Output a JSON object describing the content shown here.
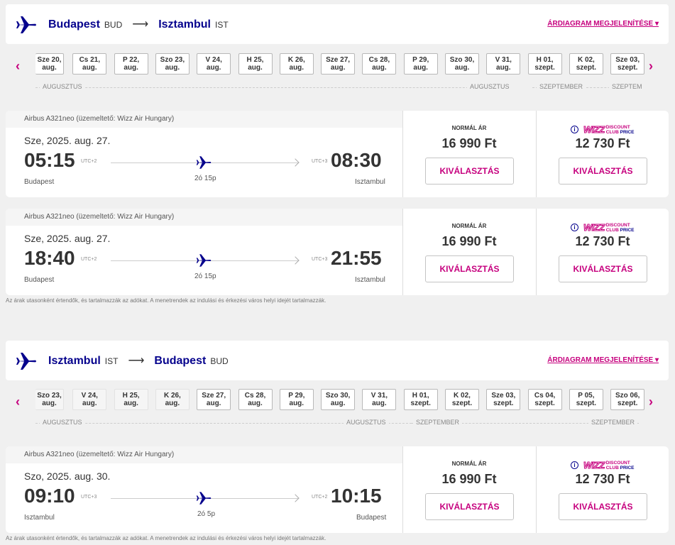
{
  "outbound": {
    "from_city": "Budapest",
    "from_code": "BUD",
    "to_city": "Isztambul",
    "to_code": "IST",
    "chart_link": "ÁRDIAGRAM MEGJELENÍTÉSE ▾",
    "dates": [
      {
        "day": "Sze 20,",
        "month": "aug."
      },
      {
        "day": "Cs 21,",
        "month": "aug."
      },
      {
        "day": "P 22,",
        "month": "aug."
      },
      {
        "day": "Szo 23,",
        "month": "aug."
      },
      {
        "day": "V 24,",
        "month": "aug."
      },
      {
        "day": "H 25,",
        "month": "aug."
      },
      {
        "day": "K 26,",
        "month": "aug."
      },
      {
        "day": "Sze 27,",
        "month": "aug."
      },
      {
        "day": "Cs 28,",
        "month": "aug."
      },
      {
        "day": "P 29,",
        "month": "aug."
      },
      {
        "day": "Szo 30,",
        "month": "aug."
      },
      {
        "day": "V 31,",
        "month": "aug."
      },
      {
        "day": "H 01,",
        "month": "szept."
      },
      {
        "day": "K 02,",
        "month": "szept."
      },
      {
        "day": "Sze 03,",
        "month": "szept."
      }
    ],
    "months": [
      "AUGUSZTUS",
      "AUGUSZTUS",
      "SZEPTEMBER",
      "SZEPTEM"
    ],
    "flights": [
      {
        "aircraft": "Airbus A321neo (üzemeltető: Wizz Air Hungary)",
        "date": "Sze, 2025. aug. 27.",
        "dep_time": "05:15",
        "dep_utc": "UTC+2",
        "dep_city": "Budapest",
        "arr_time": "08:30",
        "arr_utc": "UTC+3",
        "arr_city": "Isztambul",
        "duration": "2ó 15p",
        "normal_label": "NORMÁL ÁR",
        "normal_price": "16 990 Ft",
        "club_price": "12 730 Ft",
        "select": "KIVÁLASZTÁS"
      },
      {
        "aircraft": "Airbus A321neo (üzemeltető: Wizz Air Hungary)",
        "date": "Sze, 2025. aug. 27.",
        "dep_time": "18:40",
        "dep_utc": "UTC+2",
        "dep_city": "Budapest",
        "arr_time": "21:55",
        "arr_utc": "UTC+3",
        "arr_city": "Isztambul",
        "duration": "2ó 15p",
        "normal_label": "NORMÁL ÁR",
        "normal_price": "16 990 Ft",
        "club_price": "12 730 Ft",
        "select": "KIVÁLASZTÁS"
      }
    ],
    "note": "Az árak utasonként értendők, és tartalmazzák az adókat. A menetrendek az indulási és érkezési város helyi idejét tartalmazzák."
  },
  "return": {
    "from_city": "Isztambul",
    "from_code": "IST",
    "to_city": "Budapest",
    "to_code": "BUD",
    "chart_link": "ÁRDIAGRAM MEGJELENÍTÉSE ▾",
    "dates": [
      {
        "day": "Szo 23,",
        "month": "aug."
      },
      {
        "day": "V 24,",
        "month": "aug."
      },
      {
        "day": "H 25,",
        "month": "aug."
      },
      {
        "day": "K 26,",
        "month": "aug."
      },
      {
        "day": "Sze 27,",
        "month": "aug."
      },
      {
        "day": "Cs 28,",
        "month": "aug."
      },
      {
        "day": "P 29,",
        "month": "aug."
      },
      {
        "day": "Szo 30,",
        "month": "aug."
      },
      {
        "day": "V 31,",
        "month": "aug."
      },
      {
        "day": "H 01,",
        "month": "szept."
      },
      {
        "day": "K 02,",
        "month": "szept."
      },
      {
        "day": "Sze 03,",
        "month": "szept."
      },
      {
        "day": "Cs 04,",
        "month": "szept."
      },
      {
        "day": "P 05,",
        "month": "szept."
      },
      {
        "day": "Szo 06,",
        "month": "szept."
      }
    ],
    "months": [
      "AUGUSZTUS",
      "AUGUSZTUS",
      "SZEPTEMBER",
      "SZEPTEMBER"
    ],
    "flights": [
      {
        "aircraft": "Airbus A321neo (üzemeltető: Wizz Air Hungary)",
        "date": "Szo, 2025. aug. 30.",
        "dep_time": "09:10",
        "dep_utc": "UTC+3",
        "dep_city": "Isztambul",
        "arr_time": "10:15",
        "arr_utc": "UTC+2",
        "arr_city": "Budapest",
        "duration": "2ó 5p",
        "normal_label": "NORMÁL ÁR",
        "normal_price": "16 990 Ft",
        "club_price": "12 730 Ft",
        "select": "KIVÁLASZTÁS"
      }
    ],
    "note": "Az árak utasonként értendők, és tartalmazzák az adókat. A menetrendek az indulási és érkezési város helyi idejét tartalmazzák."
  },
  "club": {
    "word": "WIZZ",
    "line1": "DISCOUNT",
    "line2": "CLUB",
    "line3": "PRICE",
    "info": "i"
  },
  "nav": {
    "prev": "‹",
    "next": "›"
  },
  "colors": {
    "brand_navy": "#06038d",
    "brand_magenta": "#c6007e"
  }
}
